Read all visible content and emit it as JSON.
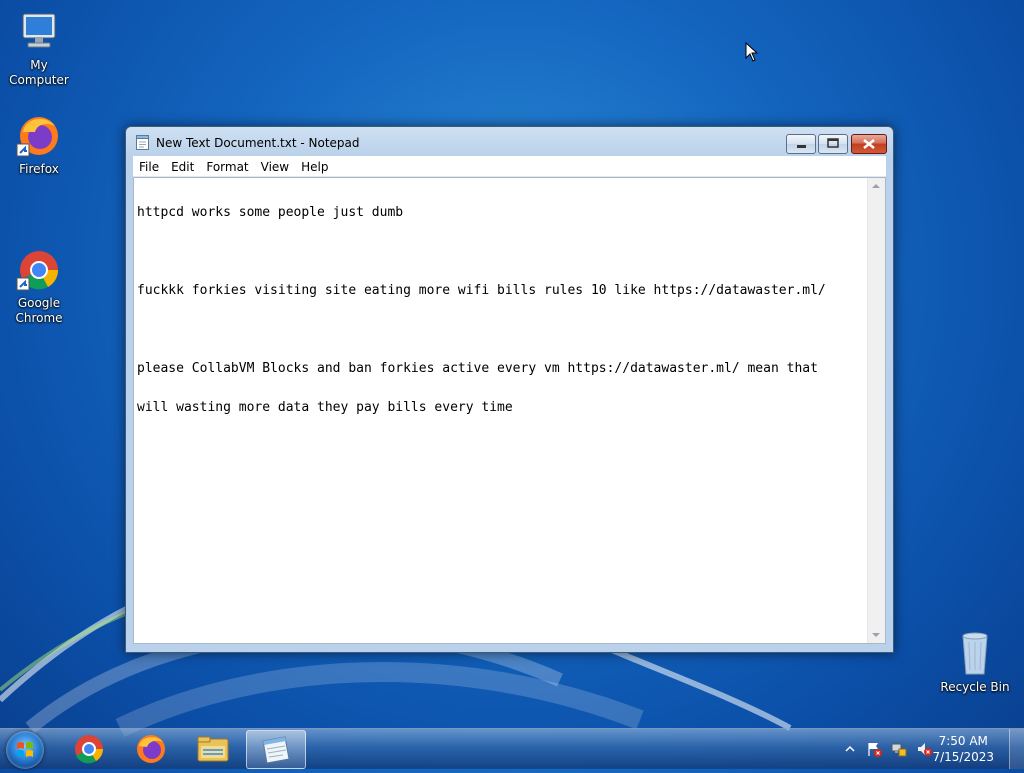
{
  "desktop": {
    "icons": [
      {
        "label": "My Computer",
        "icon": "computer-icon"
      },
      {
        "label": "Firefox",
        "icon": "firefox-icon"
      },
      {
        "label": "Google\nChrome",
        "icon": "chrome-icon"
      },
      {
        "label": "Recycle Bin",
        "icon": "recycle-bin-icon"
      }
    ]
  },
  "window": {
    "title": "New Text Document.txt - Notepad",
    "menu": [
      "File",
      "Edit",
      "Format",
      "View",
      "Help"
    ],
    "lines": [
      "httpcd works some people just dumb",
      "",
      "fuckkk forkies visiting site eating more wifi bills rules 10 like https://datawaster.ml/",
      "",
      "please CollabVM Blocks and ban forkies active every vm https://datawaster.ml/ mean that",
      "will wasting more data they pay bills every time"
    ]
  },
  "taskbar": {
    "pinned": [
      "start-orb",
      "chrome-icon",
      "firefox-icon",
      "explorer-icon",
      "notepad-icon"
    ],
    "time": "7:50 AM",
    "date": "7/15/2023"
  },
  "colors": {
    "desktop_bg": "#1466bf",
    "close_button": "#c0401f"
  }
}
